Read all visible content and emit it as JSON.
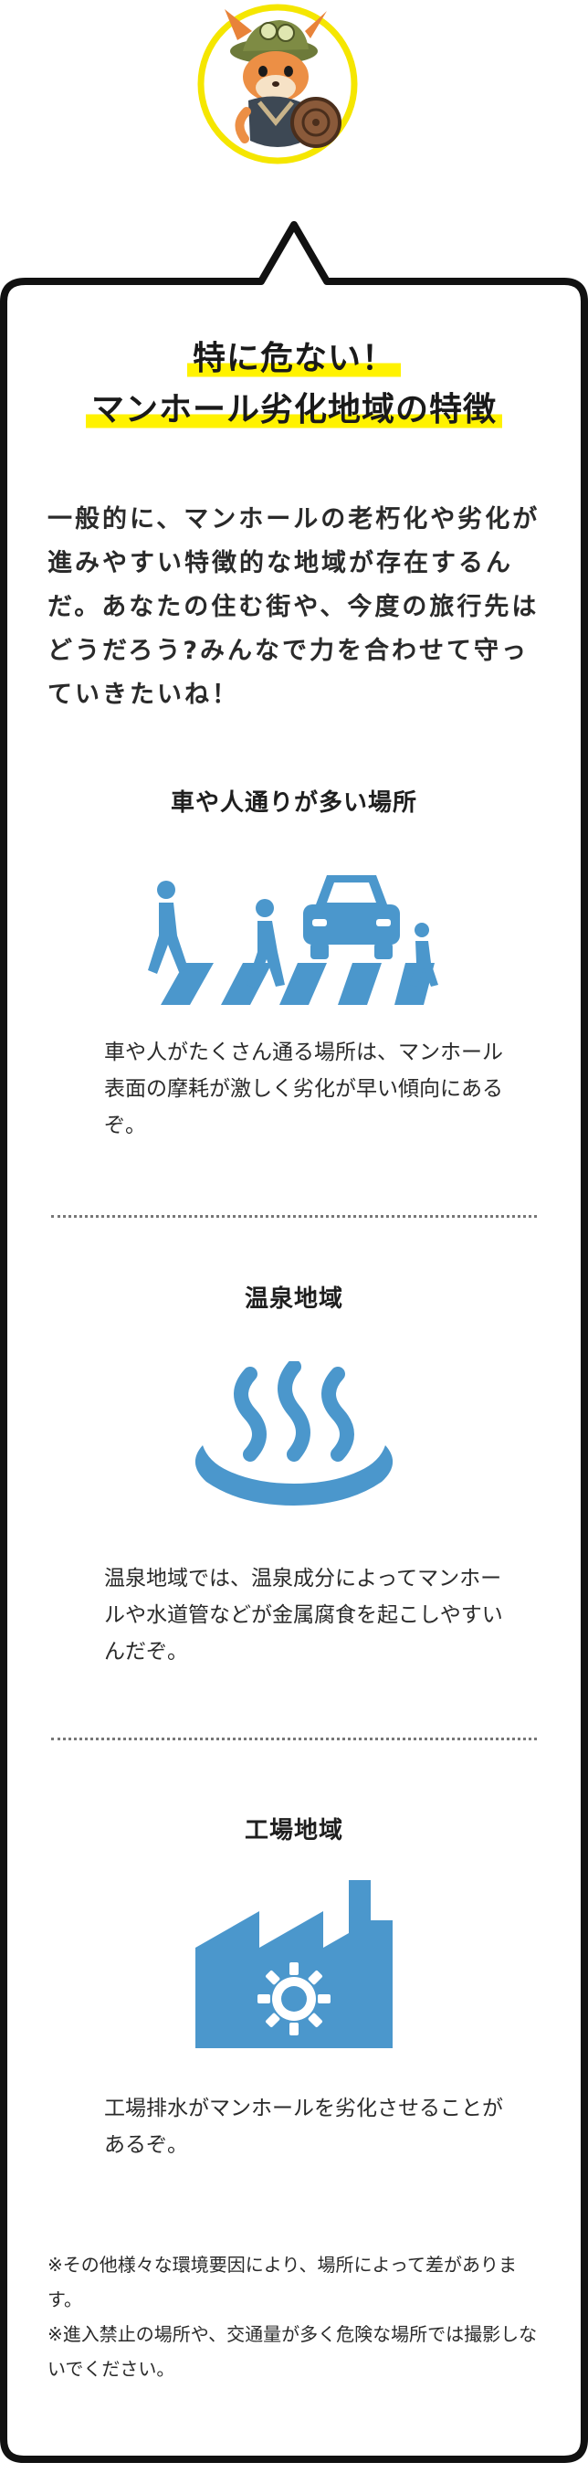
{
  "title": {
    "line1": "特に危ない！",
    "line2": "マンホール劣化地域の特徴"
  },
  "intro": "一般的に、マンホールの老朽化や劣化が進みやすい特徴的な地域が存在するんだ。あなたの住む街や、今度の旅行先はどうだろう?みんなで力を合わせて守っていきたいね！",
  "sections": [
    {
      "heading": "車や人通りが多い場所",
      "text": "車や人がたくさん通る場所は、マンホール表面の摩耗が激しく劣化が早い傾向にあるぞ。",
      "icon": "crosswalk-icon"
    },
    {
      "heading": "温泉地域",
      "text": "温泉地域では、温泉成分によってマンホールや水道管などが金属腐食を起こしやすいんだぞ。",
      "icon": "hot-spring-icon"
    },
    {
      "heading": "工場地域",
      "text": "工場排水がマンホールを劣化させることがあるぞ。",
      "icon": "factory-icon"
    }
  ],
  "notes": [
    "※その他様々な環境要因により、場所によって差があります。",
    "※進入禁止の場所や、交通量が多く危険な場所では撮影しないでください。"
  ],
  "colors": {
    "accent_blue": "#4b97cc",
    "highlight_yellow": "#fff200",
    "bubble_border": "#111111"
  }
}
